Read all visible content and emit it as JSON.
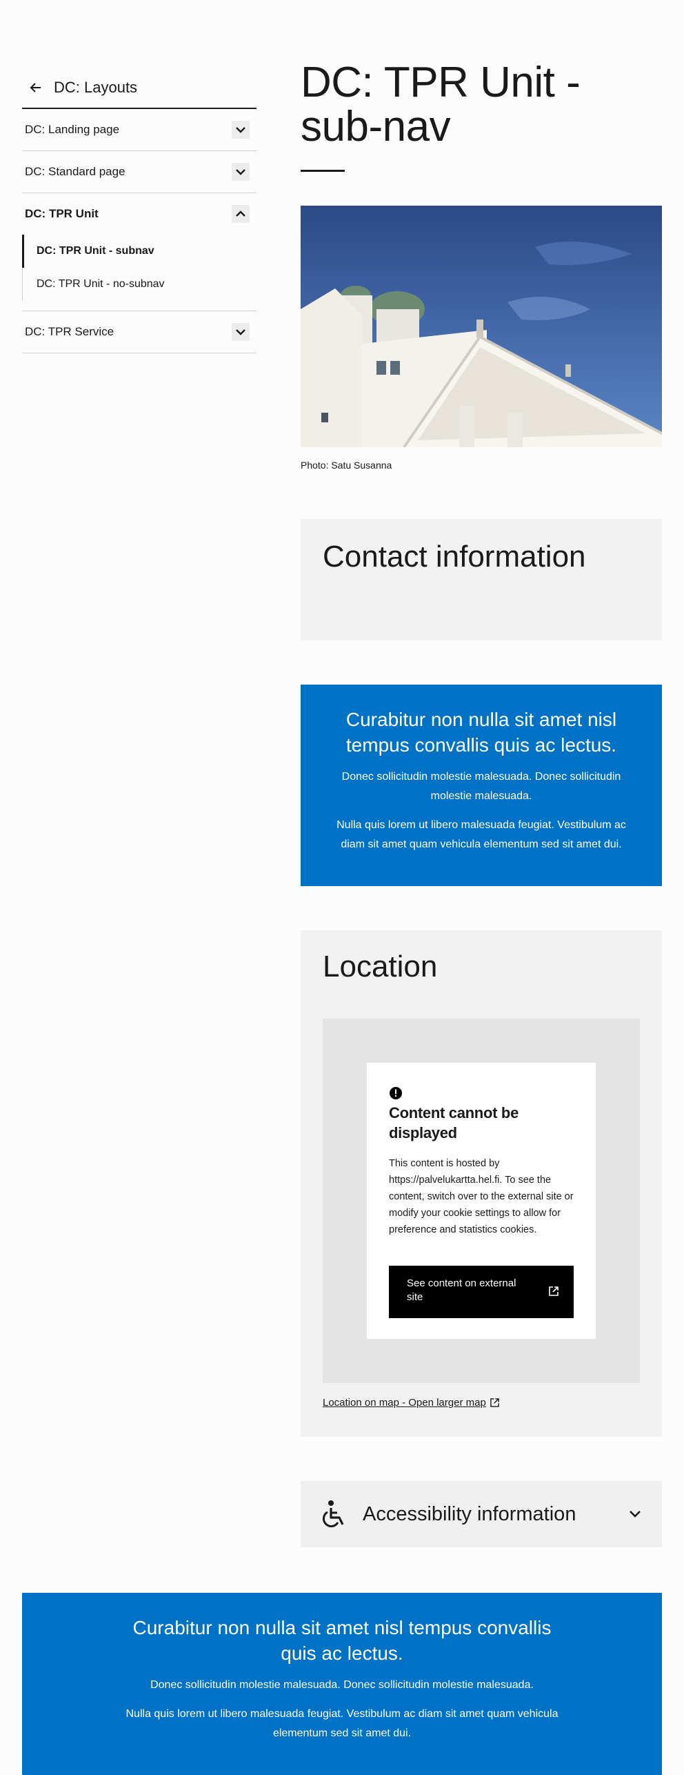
{
  "sidebar": {
    "back_label": "DC: Layouts",
    "items": [
      {
        "label": "DC: Landing page",
        "expanded": false
      },
      {
        "label": "DC: Standard page",
        "expanded": false
      },
      {
        "label": "DC: TPR Unit",
        "expanded": true,
        "children": [
          {
            "label": "DC: TPR Unit - subnav",
            "current": true
          },
          {
            "label": "DC: TPR Unit - no-subnav",
            "current": false
          }
        ]
      },
      {
        "label": "DC: TPR Service",
        "expanded": false
      }
    ]
  },
  "main": {
    "title": "DC: TPR Unit - sub-nav",
    "photo_caption": "Photo: Satu Susanna",
    "contact": {
      "heading": "Contact information"
    },
    "highlight": {
      "lead": "Curabitur non nulla sit amet nisl tempus convallis quis ac lectus.",
      "p1": "Donec sollicitudin molestie malesuada. Donec sollicitudin molestie malesuada.",
      "p2": "Nulla quis lorem ut libero malesuada feugiat. Vestibulum ac diam sit amet quam vehicula elementum sed sit amet dui."
    },
    "location": {
      "heading": "Location",
      "notice_title": "Content cannot be displayed",
      "notice_text": "This content is hosted by https://palvelukartta.hel.fi. To see the content, switch over to the external site or modify your cookie settings to allow for preference and statistics cookies.",
      "button_label": "See content on external site",
      "map_link": "Location on map - Open larger map"
    },
    "accessibility": {
      "label": "Accessibility information"
    }
  },
  "footer": {
    "lead": "Curabitur non nulla sit amet nisl tempus convallis quis ac lectus.",
    "p1": "Donec sollicitudin molestie malesuada. Donec sollicitudin molestie malesuada.",
    "p2": "Nulla quis lorem ut libero malesuada feugiat. Vestibulum ac diam sit amet quam vehicula elementum sed sit amet dui."
  },
  "colors": {
    "brand_blue": "#0072c6",
    "panel_gray": "#f2f2f2",
    "text": "#1a1a1a"
  }
}
